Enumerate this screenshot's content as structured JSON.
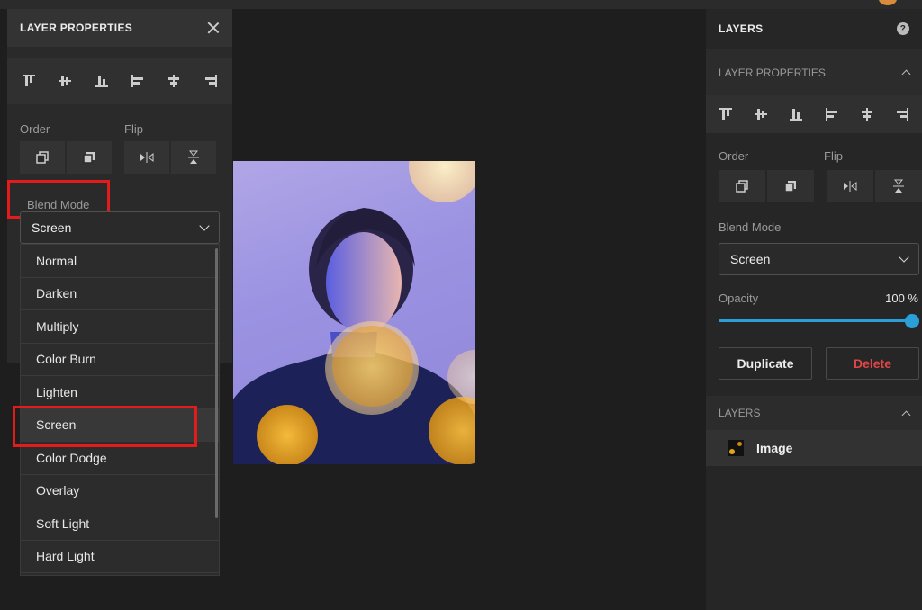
{
  "left_panel": {
    "title": "LAYER PROPERTIES",
    "align_icons": [
      "align-top-icon",
      "align-vertical-center-icon",
      "align-bottom-icon",
      "align-left-icon",
      "align-horizontal-center-icon",
      "align-right-icon"
    ],
    "order_label": "Order",
    "flip_label": "Flip",
    "blend_mode_label": "Blend Mode",
    "blend_mode_value": "Screen",
    "blend_options": [
      "Normal",
      "Darken",
      "Multiply",
      "Color Burn",
      "Lighten",
      "Screen",
      "Color Dodge",
      "Overlay",
      "Soft Light",
      "Hard Light"
    ],
    "selected_option": "Screen"
  },
  "right_panel": {
    "title": "LAYERS",
    "help_label": "?",
    "section_title": "LAYER PROPERTIES",
    "order_label": "Order",
    "flip_label": "Flip",
    "blend_mode_label": "Blend Mode",
    "blend_mode_value": "Screen",
    "opacity_label": "Opacity",
    "opacity_value": "100 %",
    "opacity_fraction": 1.0,
    "duplicate_label": "Duplicate",
    "delete_label": "Delete",
    "layers_section_title": "LAYERS",
    "layer_name": "Image"
  },
  "colors": {
    "accent": "#2a9fd8",
    "delete": "#e04646",
    "highlight": "#e21b1b"
  }
}
